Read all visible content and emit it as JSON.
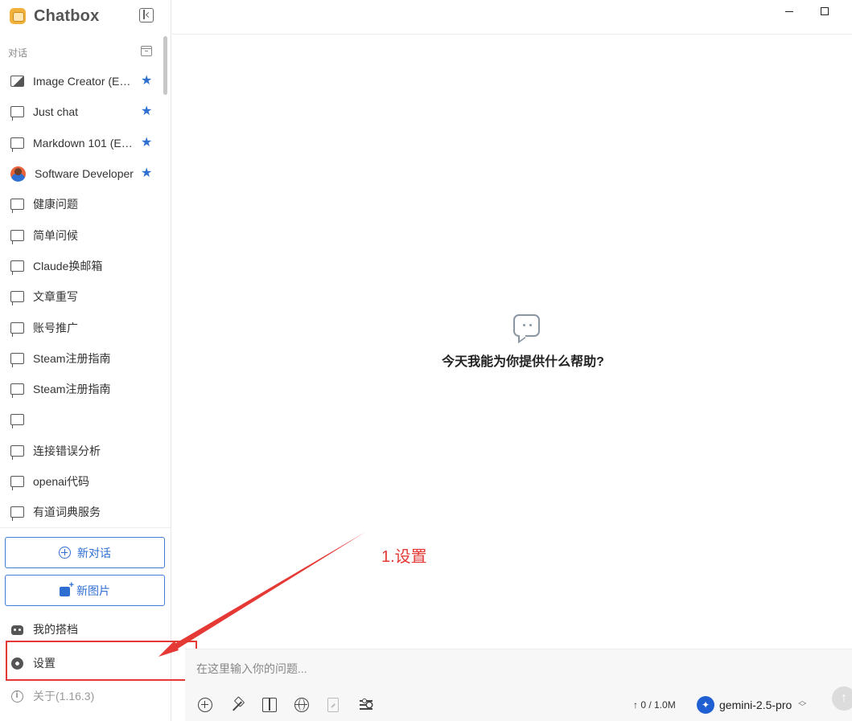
{
  "app": {
    "name": "Chatbox"
  },
  "sidebar": {
    "section_label": "对话",
    "chats": [
      {
        "label": "Image Creator (Example)",
        "icon": "image-icon",
        "starred": true
      },
      {
        "label": "Just chat",
        "icon": "chat-bubble-icon",
        "starred": true
      },
      {
        "label": "Markdown 101 (Example)",
        "icon": "chat-bubble-icon",
        "starred": true
      },
      {
        "label": "Software Developer",
        "icon": "developer-avatar-icon",
        "starred": true
      },
      {
        "label": "健康问题",
        "icon": "chat-bubble-icon",
        "starred": false
      },
      {
        "label": "简单问候",
        "icon": "chat-bubble-icon",
        "starred": false
      },
      {
        "label": "Claude换邮箱",
        "icon": "chat-bubble-icon",
        "starred": false
      },
      {
        "label": "文章重写",
        "icon": "chat-bubble-icon",
        "starred": false
      },
      {
        "label": "账号推广",
        "icon": "chat-bubble-icon",
        "starred": false
      },
      {
        "label": "Steam注册指南",
        "icon": "chat-bubble-icon",
        "starred": false
      },
      {
        "label": "Steam注册指南",
        "icon": "chat-bubble-icon",
        "starred": false
      },
      {
        "label": "",
        "icon": "chat-bubble-icon",
        "starred": false
      },
      {
        "label": "连接错误分析",
        "icon": "chat-bubble-icon",
        "starred": false
      },
      {
        "label": "openai代码",
        "icon": "chat-bubble-icon",
        "starred": false
      },
      {
        "label": "有道词典服务",
        "icon": "chat-bubble-icon",
        "starred": false
      }
    ],
    "new_chat_label": "新对话",
    "new_image_label": "新图片",
    "my_copilots_label": "我的搭档",
    "settings_label": "设置",
    "about_label": "关于(1.16.3)"
  },
  "main": {
    "empty_title": "今天我能为你提供什么帮助?"
  },
  "composer": {
    "placeholder": "在这里输入你的问题...",
    "token_count": "↑ 0 / 1.0M",
    "model_name": "gemini-2.5-pro"
  },
  "annotation": {
    "text": "1.设置",
    "color": "#e53935"
  },
  "colors": {
    "accent": "#2f6fd1",
    "annotation": "#e53935"
  }
}
